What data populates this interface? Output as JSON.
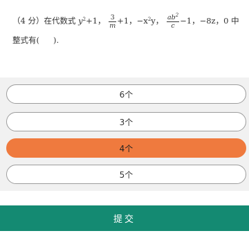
{
  "question": {
    "score": "（4 分）",
    "intro": "在代数式",
    "t1_base": "y",
    "t1_exp": "2",
    "t1_tail": "+1，",
    "f1_num": "3",
    "f1_den": "m",
    "f1_tail": "+1，−x",
    "t3_exp": "2",
    "t3_tail": "y，",
    "f2_num_a": "ab",
    "f2_num_exp": "2",
    "f2_den": "c",
    "f2_tail": "−1，−8z，0 中",
    "line2_a": "整式有(",
    "line2_b": ").",
    "colors": {
      "text": "#333333"
    }
  },
  "options": [
    {
      "label": "6个",
      "selected": false
    },
    {
      "label": "3个",
      "selected": false
    },
    {
      "label": "4个",
      "selected": true
    },
    {
      "label": "5个",
      "selected": false
    }
  ],
  "colors": {
    "panel_bg": "#f1f1f1",
    "selected_option": "#ef7a3e",
    "option_border": "#9c9c9c",
    "submit_bg": "#148a72"
  },
  "submit": {
    "label": "提交"
  }
}
